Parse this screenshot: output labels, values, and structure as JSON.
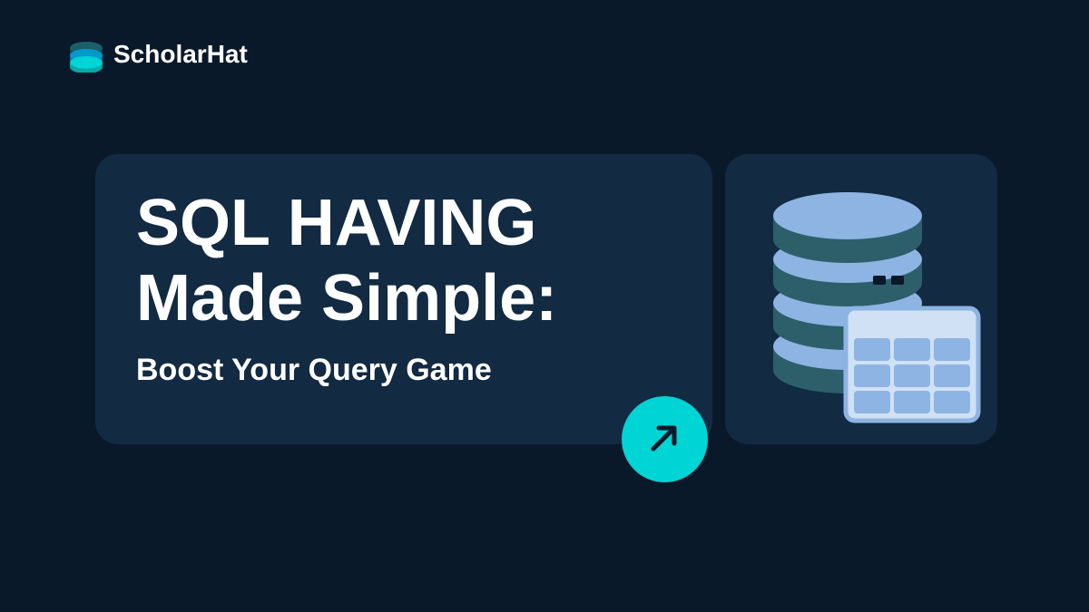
{
  "logo": {
    "text": "ScholarHat"
  },
  "card": {
    "titleLine1": "SQL HAVING",
    "titleLine2": "Made Simple:",
    "subtitle": "Boost Your Query Game"
  },
  "colors": {
    "background": "#0a1929",
    "cardBackground": "#122a42",
    "accent": "#00d4d4",
    "dbTop": "#8db4e2",
    "dbSide": "#2d5f6b",
    "tableBg": "#d0e0f5"
  }
}
